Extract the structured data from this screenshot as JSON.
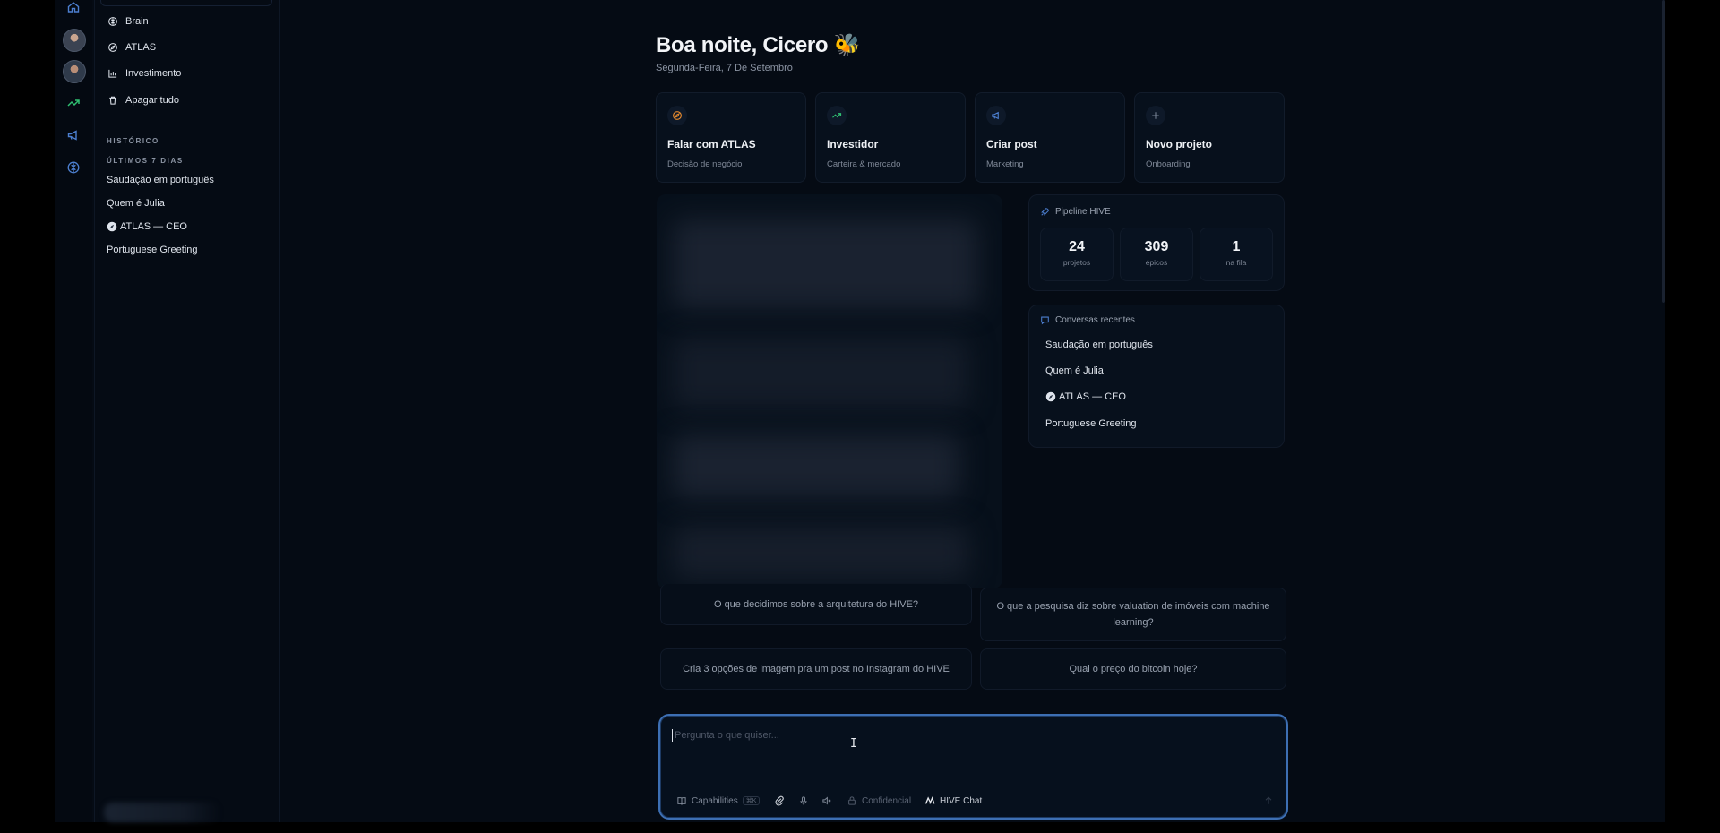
{
  "rail": {
    "icons": [
      "home-icon",
      "avatar",
      "avatar",
      "trending-up-icon",
      "megaphone-icon",
      "brain-icon"
    ]
  },
  "sidebar": {
    "items": [
      {
        "label": "Brain",
        "icon": "brain-icon"
      },
      {
        "label": "ATLAS",
        "icon": "compass-icon"
      },
      {
        "label": "Investimento",
        "icon": "chart-icon"
      },
      {
        "label": "Apagar tudo",
        "icon": "trash-icon"
      }
    ],
    "history_label": "HISTÓRICO",
    "period_label": "ÚLTIMOS 7 DIAS",
    "conversations": [
      "Saudação em português",
      "Quem é Julia",
      "ATLAS — CEO",
      "Portuguese Greeting"
    ]
  },
  "main": {
    "greeting": "Boa noite, Cicero 🐝",
    "date": "Segunda-Feira, 7 De Setembro",
    "quick_actions": [
      {
        "title": "Falar com ATLAS",
        "subtitle": "Decisão de negócio",
        "icon": "compass-icon",
        "color": "#e58a2e"
      },
      {
        "title": "Investidor",
        "subtitle": "Carteira & mercado",
        "icon": "trending-up-icon",
        "color": "#2fbf71"
      },
      {
        "title": "Criar post",
        "subtitle": "Marketing",
        "icon": "megaphone-icon",
        "color": "#4c7fd0"
      },
      {
        "title": "Novo projeto",
        "subtitle": "Onboarding",
        "icon": "plus-icon",
        "color": "#7a8597"
      }
    ],
    "pipeline": {
      "title": "Pipeline HIVE",
      "stats": [
        {
          "value": "24",
          "label": "projetos"
        },
        {
          "value": "309",
          "label": "épicos"
        },
        {
          "value": "1",
          "label": "na fila"
        }
      ]
    },
    "recent": {
      "title": "Conversas recentes",
      "items": [
        "Saudação em português",
        "Quem é Julia",
        "ATLAS — CEO",
        "Portuguese Greeting"
      ]
    },
    "suggestions": [
      "O que decidimos sobre a arquitetura do HIVE?",
      "O que a pesquisa diz sobre valuation de imóveis com machine learning?",
      "Cria 3 opções de imagem pra um post no Instagram do HIVE",
      "Qual o preço do bitcoin hoje?"
    ]
  },
  "composer": {
    "placeholder": "Pergunta o que quiser...",
    "capabilities_label": "Capabilities",
    "capabilities_kbd": "⌘K",
    "confidential_label": "Confidencial",
    "model_label": "HIVE Chat"
  },
  "colors": {
    "accent": "#3d6fb3",
    "background": "#050b14"
  }
}
